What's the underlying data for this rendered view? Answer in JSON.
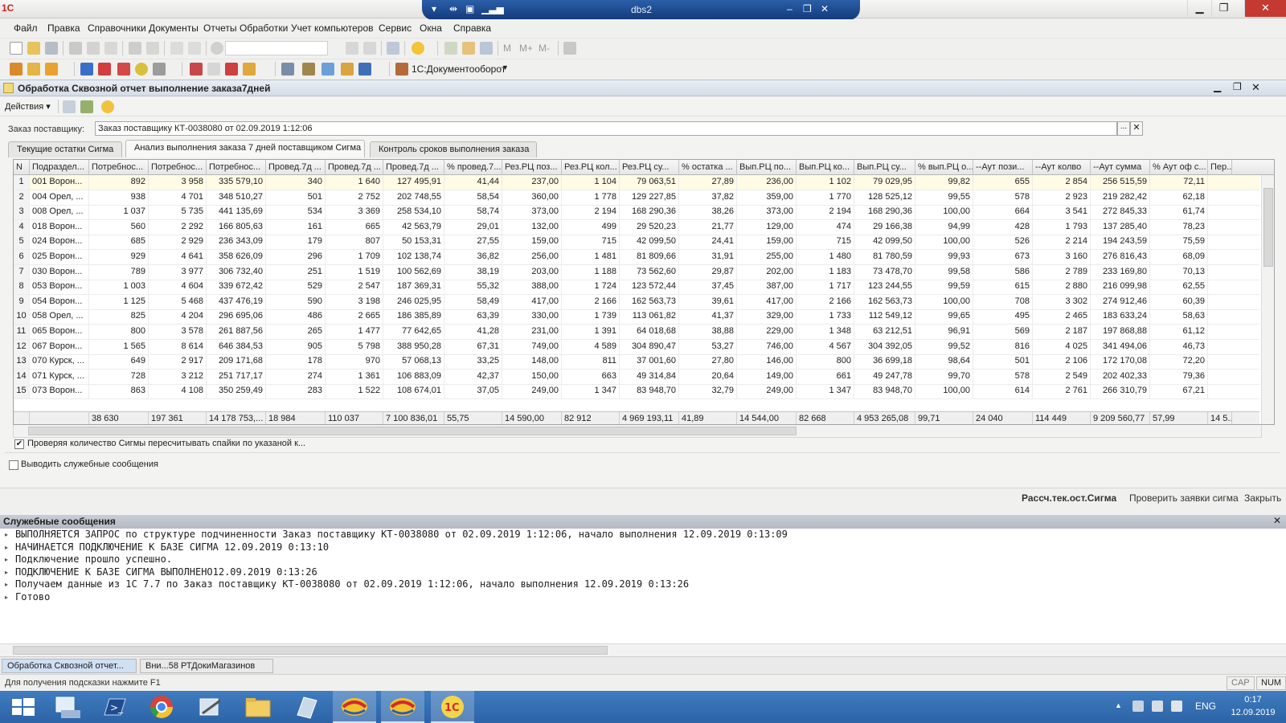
{
  "window": {
    "rdp_title": "dbs2"
  },
  "menu": [
    "Файл",
    "Правка",
    "Справочники",
    "Документы",
    "Отчеты",
    "Обработки",
    "Учет компьютеров",
    "Сервис",
    "Окна",
    "Справка"
  ],
  "toolbar2": {
    "docflow_label": "1С:Документооборот"
  },
  "form": {
    "title": "Обработка  Сквозной отчет выполнение заказа7дней",
    "actions_label": "Действия",
    "vendor_label": "Заказ поставщику:",
    "vendor_value": "Заказ поставщику КТ-0038080 от 02.09.2019 1:12:06",
    "tabs": [
      "Текущие остатки Сигма",
      "Анализ выполнения заказа 7 дней поставщиком Сигма",
      "Контроль сроков выполнения заказа"
    ],
    "checkbox1_label": "Проверяя количество Сигмы пересчитывать спайки по указаной к...",
    "checkbox1_checked": true,
    "checkbox2_label": "Выводить служебные сообщения",
    "checkbox2_checked": false,
    "links": [
      "Рассч.тек.ост.Сигма",
      "Проверить заявки сигма",
      "Закрыть"
    ]
  },
  "grid": {
    "headers": [
      "N",
      "Подраздел...",
      "Потребнос...",
      "Потребнос...",
      "Потребнос...",
      "Провед.7д ...",
      "Провед.7д ...",
      "Провед.7д ...",
      "% провед.7...",
      "Рез.РЦ поз...",
      "Рез.РЦ кол...",
      "Рез.РЦ су...",
      "% остатка ...",
      "Вып.РЦ по...",
      "Вып.РЦ ко...",
      "Вып.РЦ су...",
      "% вып.РЦ о...",
      "--Аут  пози...",
      "--Аут колво",
      "--Аут сумма",
      "% Аут оф с...",
      "Пер..."
    ],
    "rows": [
      [
        "1",
        "001 Ворон...",
        "892",
        "3 958",
        "335 579,10",
        "340",
        "1 640",
        "127 495,91",
        "41,44",
        "237,00",
        "1 104",
        "79 063,51",
        "27,89",
        "236,00",
        "1 102",
        "79 029,95",
        "99,82",
        "655",
        "2 854",
        "256 515,59",
        "72,11"
      ],
      [
        "2",
        "004 Орел, ...",
        "938",
        "4 701",
        "348 510,27",
        "501",
        "2 752",
        "202 748,55",
        "58,54",
        "360,00",
        "1 778",
        "129 227,85",
        "37,82",
        "359,00",
        "1 770",
        "128 525,12",
        "99,55",
        "578",
        "2 923",
        "219 282,42",
        "62,18"
      ],
      [
        "3",
        "008 Орел, ...",
        "1 037",
        "5 735",
        "441 135,69",
        "534",
        "3 369",
        "258 534,10",
        "58,74",
        "373,00",
        "2 194",
        "168 290,36",
        "38,26",
        "373,00",
        "2 194",
        "168 290,36",
        "100,00",
        "664",
        "3 541",
        "272 845,33",
        "61,74"
      ],
      [
        "4",
        "018 Ворон...",
        "560",
        "2 292",
        "166 805,63",
        "161",
        "665",
        "42 563,79",
        "29,01",
        "132,00",
        "499",
        "29 520,23",
        "21,77",
        "129,00",
        "474",
        "29 166,38",
        "94,99",
        "428",
        "1 793",
        "137 285,40",
        "78,23"
      ],
      [
        "5",
        "024 Ворон...",
        "685",
        "2 929",
        "236 343,09",
        "179",
        "807",
        "50 153,31",
        "27,55",
        "159,00",
        "715",
        "42 099,50",
        "24,41",
        "159,00",
        "715",
        "42 099,50",
        "100,00",
        "526",
        "2 214",
        "194 243,59",
        "75,59"
      ],
      [
        "6",
        "025 Ворон...",
        "929",
        "4 641",
        "358 626,09",
        "296",
        "1 709",
        "102 138,74",
        "36,82",
        "256,00",
        "1 481",
        "81 809,66",
        "31,91",
        "255,00",
        "1 480",
        "81 780,59",
        "99,93",
        "673",
        "3 160",
        "276 816,43",
        "68,09"
      ],
      [
        "7",
        "030 Ворон...",
        "789",
        "3 977",
        "306 732,40",
        "251",
        "1 519",
        "100 562,69",
        "38,19",
        "203,00",
        "1 188",
        "73 562,60",
        "29,87",
        "202,00",
        "1 183",
        "73 478,70",
        "99,58",
        "586",
        "2 789",
        "233 169,80",
        "70,13"
      ],
      [
        "8",
        "053 Ворон...",
        "1 003",
        "4 604",
        "339 672,42",
        "529",
        "2 547",
        "187 369,31",
        "55,32",
        "388,00",
        "1 724",
        "123 572,44",
        "37,45",
        "387,00",
        "1 717",
        "123 244,55",
        "99,59",
        "615",
        "2 880",
        "216 099,98",
        "62,55"
      ],
      [
        "9",
        "054 Ворон...",
        "1 125",
        "5 468",
        "437 476,19",
        "590",
        "3 198",
        "246 025,95",
        "58,49",
        "417,00",
        "2 166",
        "162 563,73",
        "39,61",
        "417,00",
        "2 166",
        "162 563,73",
        "100,00",
        "708",
        "3 302",
        "274 912,46",
        "60,39"
      ],
      [
        "10",
        "058 Орел, ...",
        "825",
        "4 204",
        "296 695,06",
        "486",
        "2 665",
        "186 385,89",
        "63,39",
        "330,00",
        "1 739",
        "113 061,82",
        "41,37",
        "329,00",
        "1 733",
        "112 549,12",
        "99,65",
        "495",
        "2 465",
        "183 633,24",
        "58,63"
      ],
      [
        "11",
        "065 Ворон...",
        "800",
        "3 578",
        "261 887,56",
        "265",
        "1 477",
        "77 642,65",
        "41,28",
        "231,00",
        "1 391",
        "64 018,68",
        "38,88",
        "229,00",
        "1 348",
        "63 212,51",
        "96,91",
        "569",
        "2 187",
        "197 868,88",
        "61,12"
      ],
      [
        "12",
        "067 Ворон...",
        "1 565",
        "8 614",
        "646 384,53",
        "905",
        "5 798",
        "388 950,28",
        "67,31",
        "749,00",
        "4 589",
        "304 890,47",
        "53,27",
        "746,00",
        "4 567",
        "304 392,05",
        "99,52",
        "816",
        "4 025",
        "341 494,06",
        "46,73"
      ],
      [
        "13",
        "070 Курск, ...",
        "649",
        "2 917",
        "209 171,68",
        "178",
        "970",
        "57 068,13",
        "33,25",
        "148,00",
        "811",
        "37 001,60",
        "27,80",
        "146,00",
        "800",
        "36 699,18",
        "98,64",
        "501",
        "2 106",
        "172 170,08",
        "72,20"
      ],
      [
        "14",
        "071 Курск, ...",
        "728",
        "3 212",
        "251 717,17",
        "274",
        "1 361",
        "106 883,09",
        "42,37",
        "150,00",
        "663",
        "49 314,84",
        "20,64",
        "149,00",
        "661",
        "49 247,78",
        "99,70",
        "578",
        "2 549",
        "202 402,33",
        "79,36"
      ],
      [
        "15",
        "073 Ворон...",
        "863",
        "4 108",
        "350 259,49",
        "283",
        "1 522",
        "108 674,01",
        "37,05",
        "249,00",
        "1 347",
        "83 948,70",
        "32,79",
        "249,00",
        "1 347",
        "83 948,70",
        "100,00",
        "614",
        "2 761",
        "266 310,79",
        "67,21"
      ]
    ],
    "totals": [
      "",
      "",
      "38 630",
      "197 361",
      "14 178 753,...",
      "18 984",
      "110 037",
      "7 100 836,01",
      "55,75",
      "14 590,00",
      "82 912",
      "4 969 193,11",
      "41,89",
      "14 544,00",
      "82 668",
      "4 953 265,08",
      "99,71",
      "24 040",
      "114 449",
      "9 209 560,77",
      "57,99",
      "14 5..."
    ]
  },
  "messages": {
    "title": "Служебные сообщения",
    "lines": [
      "ВЫПОЛНЯЕТСЯ ЗАПРОС по структуре подчиненности Заказ поставщику КТ-0038080 от 02.09.2019 1:12:06, начало выполнения 12.09.2019 0:13:09",
      "НАЧИНАЕТСЯ ПОДКЛЮЧЕНИЕ К БАЗЕ СИГМА 12.09.2019 0:13:10",
      "Подключение прошло успешно.",
      "ПОДКЛЮЧЕНИЕ К БАЗЕ СИГМА ВЫПОЛНЕНО12.09.2019 0:13:26",
      "Получаем данные из 1С 7.7 по Заказ поставщику КТ-0038080 от 02.09.2019 1:12:06, начало выполнения 12.09.2019 0:13:26",
      "Готово"
    ]
  },
  "window_tabs": [
    "Обработка  Сквозной отчет...",
    "Вни...58 РТДокиМагазинов"
  ],
  "status": {
    "hint": "Для получения подсказки нажмите F1",
    "cap": "CAP",
    "num": "NUM"
  },
  "taskbar": {
    "lang": "ENG",
    "time": "0:17",
    "date": "12.09.2019",
    "apps": [
      "start-button",
      "file-explorer-icon",
      "powershell-icon",
      "chrome-icon",
      "tools-icon",
      "folder-icon",
      "notepad-icon",
      "1c77-icon",
      "1c77-icon-2",
      "1c-enterprise-icon"
    ]
  },
  "colors": {
    "accent": "#2c63a6",
    "selected_row": "#fffbe5",
    "close_red": "#c43a31"
  }
}
